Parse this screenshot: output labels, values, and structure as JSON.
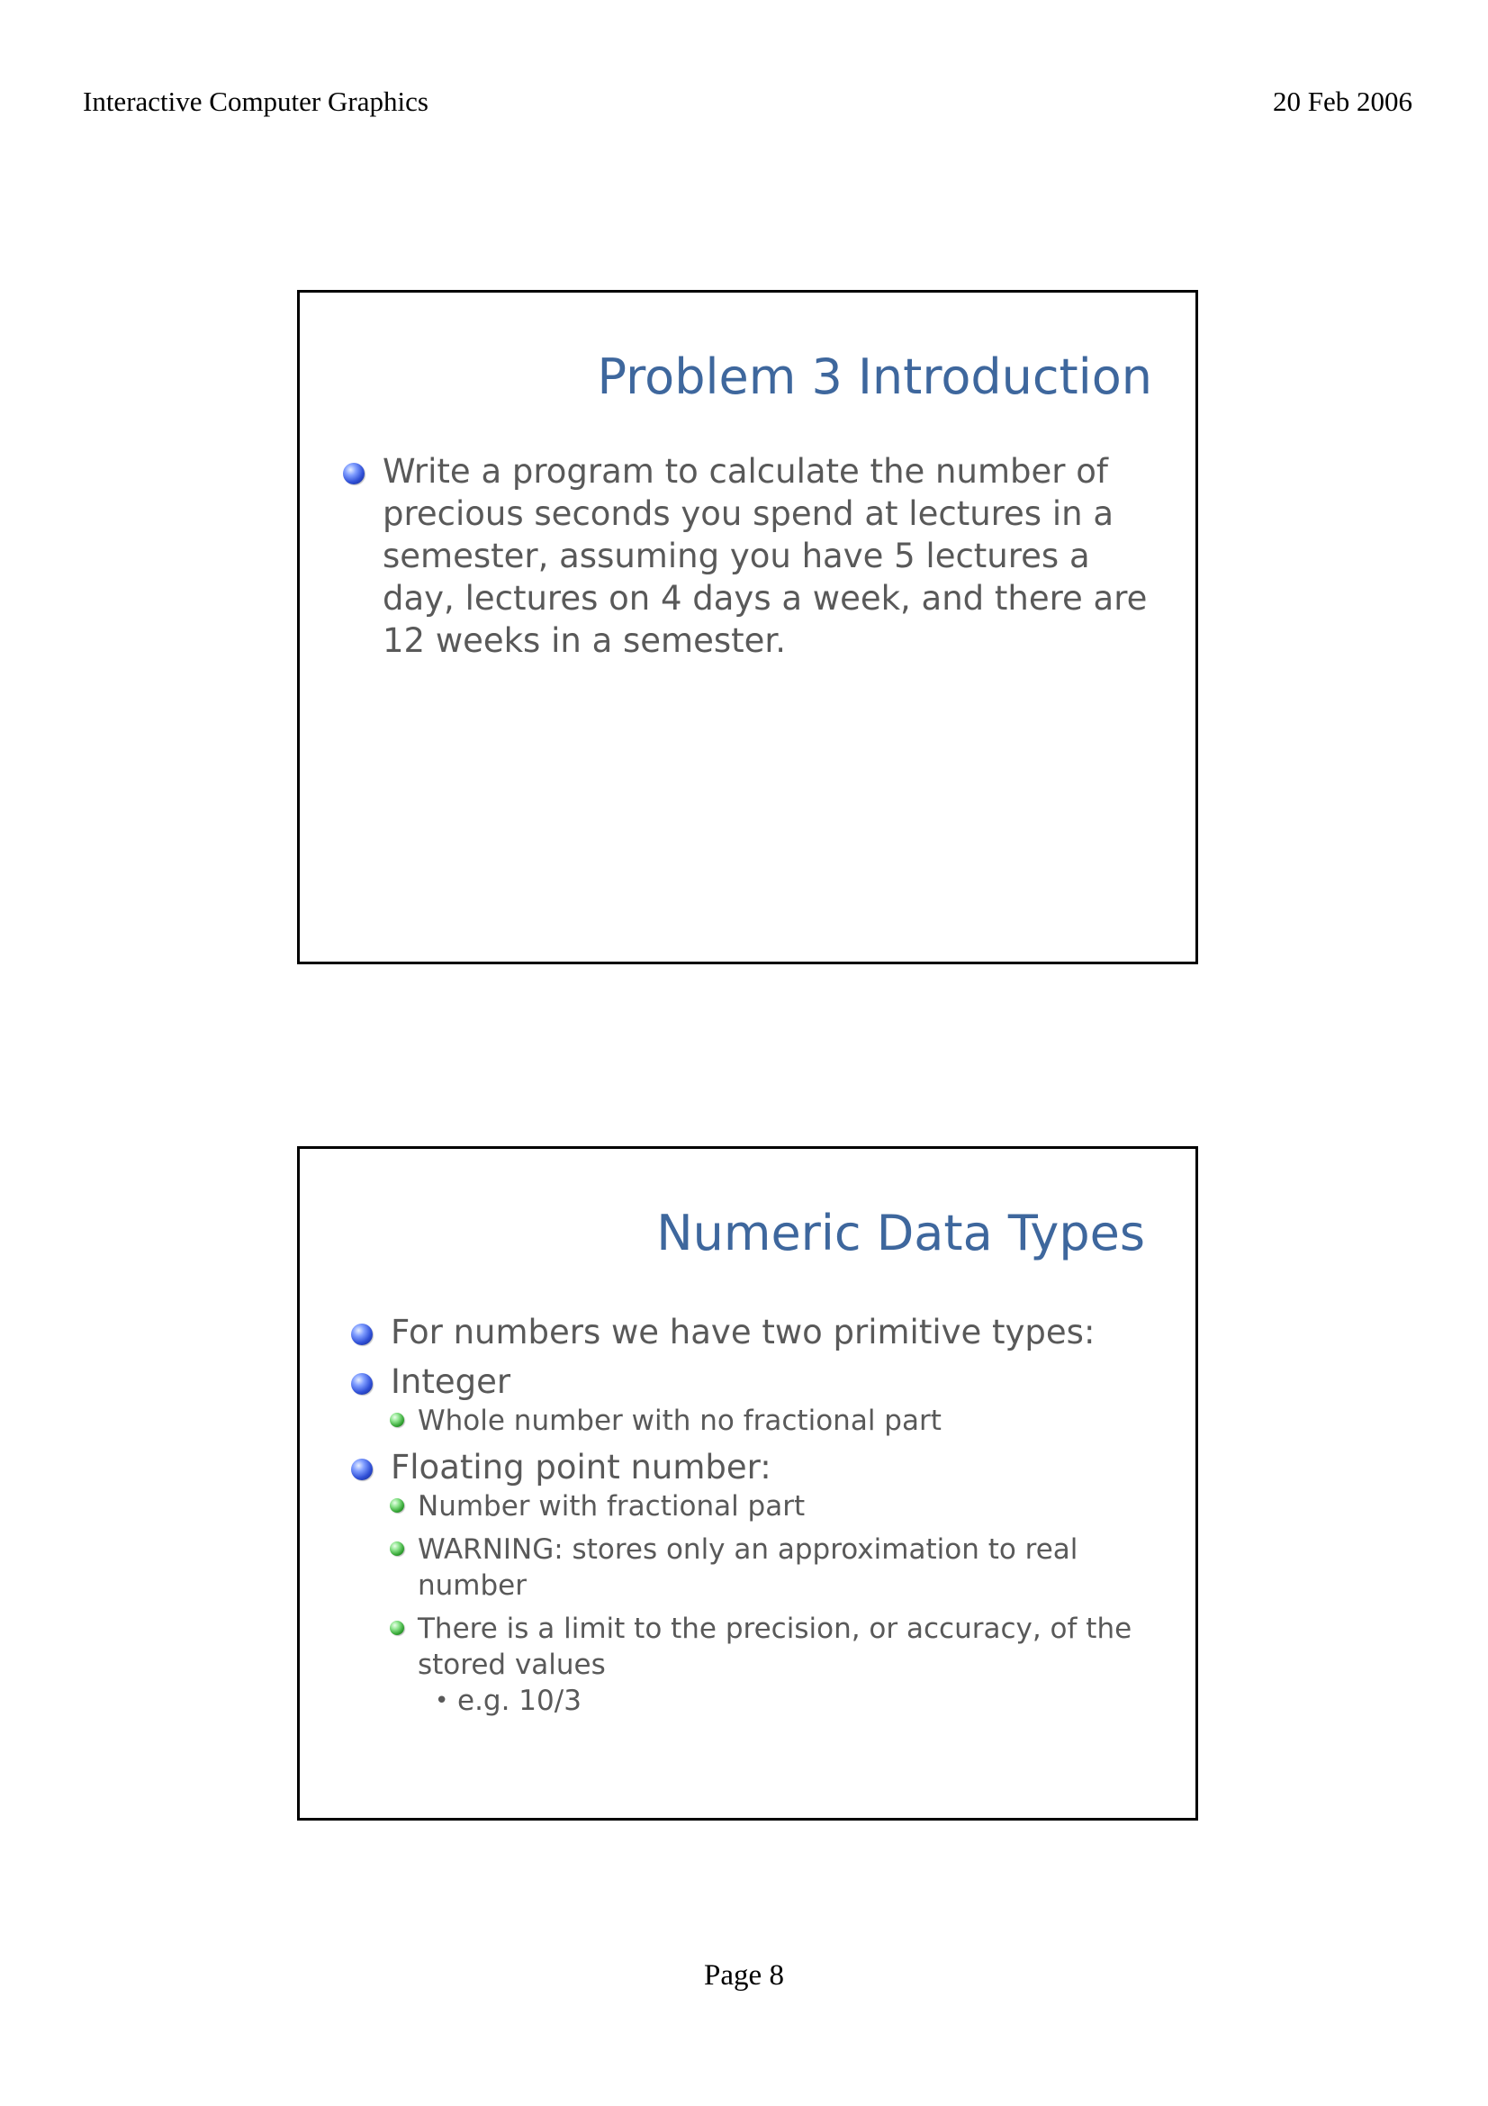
{
  "header": {
    "left": "Interactive Computer Graphics",
    "right": "20 Feb 2006"
  },
  "footer": {
    "page": "Page 8"
  },
  "slide1": {
    "title": "Problem 3 Introduction",
    "bullets": [
      "Write a program to calculate the number of precious seconds you spend at lectures in a semester, assuming you have 5 lectures a day, lectures on 4 days a week, and there are 12 weeks in a semester."
    ]
  },
  "slide2": {
    "title": "Numeric Data Types",
    "bullets": [
      {
        "text": "For numbers we have two primitive types:"
      },
      {
        "text": "Integer",
        "sub": [
          "Whole number with no fractional part"
        ]
      },
      {
        "text": "Floating point number:",
        "sub": [
          "Number with fractional part",
          "WARNING: stores only an approximation to real number",
          "There is a limit to the precision, or accuracy, of the stored values"
        ],
        "subsub": [
          "e.g. 10/3"
        ]
      }
    ]
  },
  "colors": {
    "title": "#3e679d",
    "body_text": "#595959",
    "bullet_level1": "#2f4fd6",
    "bullet_level2": "#34a534"
  },
  "icons": {
    "level1": "blue-sphere-bullet-icon",
    "level2": "green-sphere-bullet-icon",
    "level3": "small-dot-bullet-icon"
  }
}
